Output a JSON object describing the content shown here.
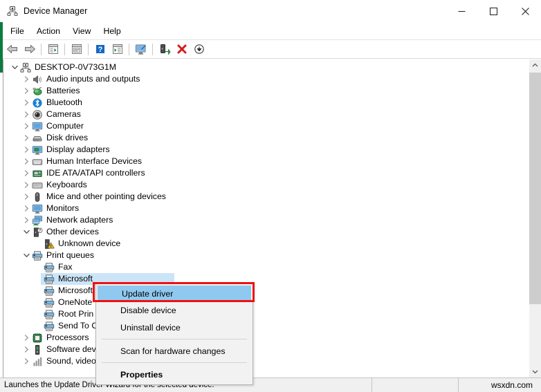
{
  "window": {
    "title": "Device Manager",
    "icon": "device-manager-icon"
  },
  "caption": {
    "minimize": "minimize-icon",
    "maximize": "maximize-icon",
    "close": "close-icon"
  },
  "menubar": {
    "items": [
      {
        "label": "File"
      },
      {
        "label": "Action"
      },
      {
        "label": "View"
      },
      {
        "label": "Help"
      }
    ]
  },
  "toolbar": {
    "buttons": [
      {
        "name": "back-icon"
      },
      {
        "name": "forward-icon"
      },
      {
        "name": "separator"
      },
      {
        "name": "show-hide-console-tree-icon"
      },
      {
        "name": "separator"
      },
      {
        "name": "properties-icon"
      },
      {
        "name": "separator"
      },
      {
        "name": "help-icon"
      },
      {
        "name": "show-hide-action-pane-icon"
      },
      {
        "name": "separator"
      },
      {
        "name": "scan-for-hardware-changes-icon"
      },
      {
        "name": "separator"
      },
      {
        "name": "update-driver-icon"
      },
      {
        "name": "uninstall-device-icon"
      },
      {
        "name": "disable-device-icon"
      }
    ]
  },
  "tree": {
    "rows": [
      {
        "label": "DESKTOP-0V73G1M",
        "depth": 0,
        "state": "expanded",
        "icon": "computer-root-icon",
        "selected": false
      },
      {
        "label": "Audio inputs and outputs",
        "depth": 1,
        "state": "collapsed",
        "icon": "speaker-icon",
        "selected": false
      },
      {
        "label": "Batteries",
        "depth": 1,
        "state": "collapsed",
        "icon": "battery-icon",
        "selected": false
      },
      {
        "label": "Bluetooth",
        "depth": 1,
        "state": "collapsed",
        "icon": "bluetooth-icon",
        "selected": false
      },
      {
        "label": "Cameras",
        "depth": 1,
        "state": "collapsed",
        "icon": "camera-icon",
        "selected": false
      },
      {
        "label": "Computer",
        "depth": 1,
        "state": "collapsed",
        "icon": "monitor-icon",
        "selected": false
      },
      {
        "label": "Disk drives",
        "depth": 1,
        "state": "collapsed",
        "icon": "disk-drive-icon",
        "selected": false
      },
      {
        "label": "Display adapters",
        "depth": 1,
        "state": "collapsed",
        "icon": "display-adapter-icon",
        "selected": false
      },
      {
        "label": "Human Interface Devices",
        "depth": 1,
        "state": "collapsed",
        "icon": "hid-icon",
        "selected": false
      },
      {
        "label": "IDE ATA/ATAPI controllers",
        "depth": 1,
        "state": "collapsed",
        "icon": "ide-controller-icon",
        "selected": false
      },
      {
        "label": "Keyboards",
        "depth": 1,
        "state": "collapsed",
        "icon": "keyboard-icon",
        "selected": false
      },
      {
        "label": "Mice and other pointing devices",
        "depth": 1,
        "state": "collapsed",
        "icon": "mouse-icon",
        "selected": false
      },
      {
        "label": "Monitors",
        "depth": 1,
        "state": "collapsed",
        "icon": "monitor-icon",
        "selected": false
      },
      {
        "label": "Network adapters",
        "depth": 1,
        "state": "collapsed",
        "icon": "network-adapter-icon",
        "selected": false
      },
      {
        "label": "Other devices",
        "depth": 1,
        "state": "expanded",
        "icon": "other-device-icon",
        "selected": false
      },
      {
        "label": "Unknown device",
        "depth": 2,
        "state": "leaf",
        "icon": "unknown-device-warning-icon",
        "selected": false
      },
      {
        "label": "Print queues",
        "depth": 1,
        "state": "expanded",
        "icon": "printer-icon",
        "selected": false
      },
      {
        "label": "Fax",
        "depth": 2,
        "state": "leaf",
        "icon": "printer-icon",
        "selected": false
      },
      {
        "label": "Microsoft",
        "depth": 2,
        "state": "leaf",
        "icon": "printer-icon",
        "selected": true
      },
      {
        "label": "Microsoft",
        "depth": 2,
        "state": "leaf",
        "icon": "printer-icon",
        "selected": false
      },
      {
        "label": "OneNote",
        "depth": 2,
        "state": "leaf",
        "icon": "printer-icon",
        "selected": false
      },
      {
        "label": "Root Prin",
        "depth": 2,
        "state": "leaf",
        "icon": "printer-icon",
        "selected": false
      },
      {
        "label": "Send To O",
        "depth": 2,
        "state": "leaf",
        "icon": "printer-icon",
        "selected": false
      },
      {
        "label": "Processors",
        "depth": 1,
        "state": "collapsed",
        "icon": "processor-icon",
        "selected": false
      },
      {
        "label": "Software dev",
        "depth": 1,
        "state": "collapsed",
        "icon": "software-device-icon",
        "selected": false
      },
      {
        "label": "Sound, video",
        "depth": 1,
        "state": "collapsed",
        "icon": "sound-video-icon",
        "selected": false
      }
    ]
  },
  "context_menu": {
    "items": [
      {
        "label": "Update driver",
        "highlighted": true,
        "bold": false,
        "separator_after": false
      },
      {
        "label": "Disable device",
        "highlighted": false,
        "bold": false,
        "separator_after": false
      },
      {
        "label": "Uninstall device",
        "highlighted": false,
        "bold": false,
        "separator_after": true
      },
      {
        "label": "Scan for hardware changes",
        "highlighted": false,
        "bold": false,
        "separator_after": true
      },
      {
        "label": "Properties",
        "highlighted": false,
        "bold": true,
        "separator_after": false
      }
    ]
  },
  "statusbar": {
    "message": "Launches the Update Driver Wizard for the selected device.",
    "middle": "",
    "watermark": "wsxdn.com"
  },
  "colors": {
    "accent_green": "#0c7b3e",
    "selection_blue": "#cce4f7",
    "menu_highlight": "#8fc9f0",
    "red_box": "#ee1111",
    "status_bg": "#f0f0f0"
  }
}
